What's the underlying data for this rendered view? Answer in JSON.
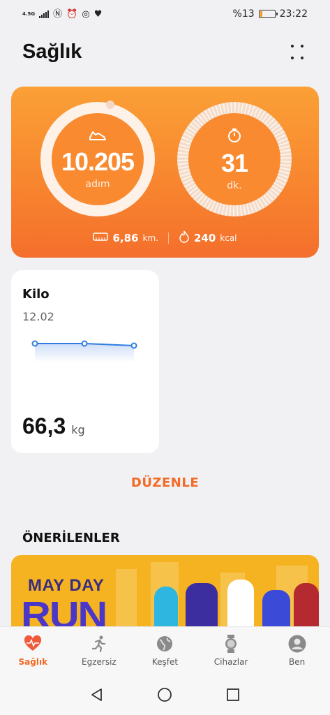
{
  "status_bar": {
    "network": "4.5G",
    "battery_text": "%13",
    "battery_level": 0.13,
    "time": "23:22",
    "icons": [
      "signal-icon",
      "nfc-icon",
      "alarm-icon",
      "instagram-icon",
      "health-heart-icon"
    ]
  },
  "header": {
    "title": "Sağlık"
  },
  "activity": {
    "steps_value": "10.205",
    "steps_unit": "adım",
    "minutes_value": "31",
    "minutes_unit": "dk.",
    "distance_value": "6,86",
    "distance_unit": "km.",
    "calories_value": "240",
    "calories_unit": "kcal",
    "accent_color": "#f8862f"
  },
  "weight": {
    "title": "Kilo",
    "date": "12.02",
    "value": "66,3",
    "unit": "kg"
  },
  "edit_label": "DÜZENLE",
  "recommendations": {
    "title": "ÖNERİLENLER",
    "banner_line1": "MAY DAY",
    "banner_line2": "RUN"
  },
  "bottom_nav": {
    "items": [
      {
        "label": "Sağlık",
        "icon": "heart-pulse-icon",
        "active": true
      },
      {
        "label": "Egzersiz",
        "icon": "running-icon",
        "active": false
      },
      {
        "label": "Keşfet",
        "icon": "globe-icon",
        "active": false
      },
      {
        "label": "Cihazlar",
        "icon": "watch-icon",
        "active": false
      },
      {
        "label": "Ben",
        "icon": "person-icon",
        "active": false
      }
    ]
  },
  "system_nav": [
    "back-icon",
    "home-icon",
    "recents-icon"
  ]
}
